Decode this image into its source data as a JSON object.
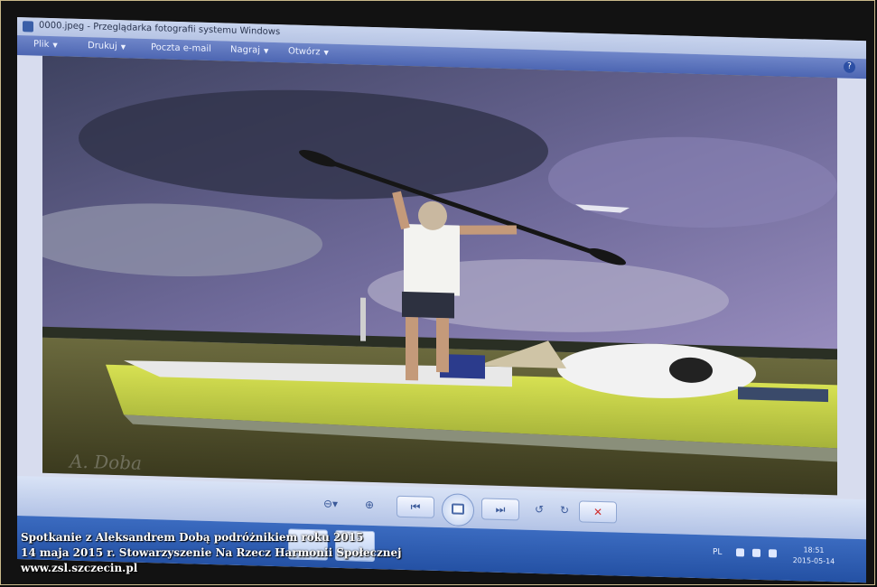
{
  "window": {
    "title": "0000.jpeg - Przeglądarka fotografii systemu Windows",
    "menu": [
      {
        "label": "Plik",
        "has_dropdown": true
      },
      {
        "label": "Drukuj",
        "has_dropdown": true
      },
      {
        "label": "Poczta e-mail",
        "has_dropdown": false
      },
      {
        "label": "Nagraj",
        "has_dropdown": true
      },
      {
        "label": "Otwórz",
        "has_dropdown": true
      }
    ],
    "help_label": "?"
  },
  "photo": {
    "description_icon": "photo-kayaker",
    "watermark_text": "A. Doba"
  },
  "viewer_toolbar": {
    "zoom_icon": "zoom-icon",
    "fit_icon": "fit-icon",
    "prev_icon": "previous-icon",
    "slideshow_icon": "slideshow-icon",
    "next_icon": "next-icon",
    "rotate_left_icon": "rotate-left-icon",
    "rotate_right_icon": "rotate-right-icon",
    "delete_icon": "delete-icon"
  },
  "taskbar": {
    "language": "PL",
    "clock_time": "18:51",
    "clock_date": "2015-05-14"
  },
  "caption": {
    "line1": "Spotkanie z Aleksandrem Dobą podróżnikiem roku 2015",
    "line2": "14 maja 2015 r. Stowarzyszenie Na Rzecz Harmonii Społecznej",
    "line3": "www.zsl.szczecin.pl"
  },
  "colors": {
    "boat": "#c9d84a",
    "sky_top": "#4a4f7a",
    "menubar": "#5a72bb",
    "delete": "#d03030"
  }
}
